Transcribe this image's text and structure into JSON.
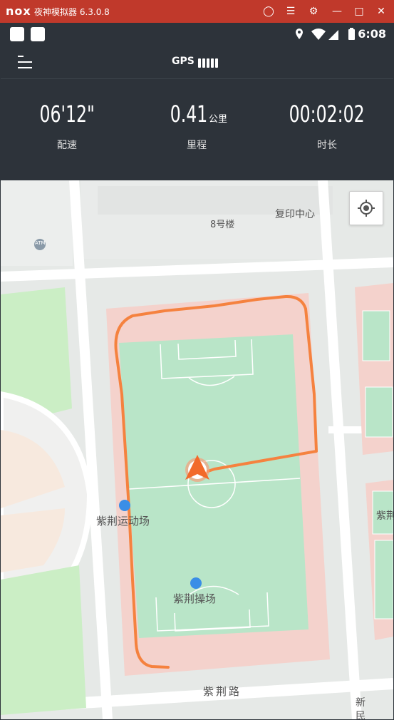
{
  "window": {
    "logo": "nox",
    "title": "夜神模拟器 6.3.0.8"
  },
  "statusbar": {
    "time": "6:08"
  },
  "appbar": {
    "gps_label": "GPS"
  },
  "stats": [
    {
      "value": "06'12\"",
      "unit": "",
      "label": "配速"
    },
    {
      "value": "0.41",
      "unit": "公里",
      "label": "里程"
    },
    {
      "value": "00:02:02",
      "unit": "",
      "label": "时长"
    }
  ],
  "map": {
    "labels": {
      "building": "8号楼",
      "print_center": "复印中心",
      "atm": "ATM",
      "sports_field": "紫荆运动场",
      "playground": "紫荆操场",
      "road_zijing": "紫荆路",
      "road_xinmin": "新民路",
      "edge_label": "紫荆"
    },
    "colors": {
      "track": "#f4d2cc",
      "field": "#b9e5c8",
      "route": "#f5823f"
    }
  }
}
